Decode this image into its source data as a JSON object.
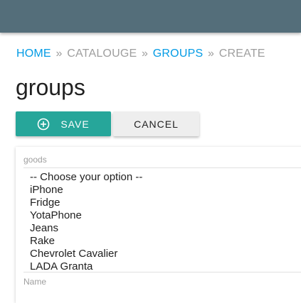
{
  "breadcrumb": {
    "items": [
      {
        "label": "HOME",
        "link": true
      },
      {
        "label": "CATALOUGE",
        "link": false
      },
      {
        "label": "GROUPS",
        "link": true
      },
      {
        "label": "CREATE",
        "link": false
      }
    ],
    "separator": "»"
  },
  "page": {
    "title": "groups"
  },
  "actions": {
    "save_label": "SAVE",
    "save_icon": "add-circle-icon",
    "cancel_label": "CANCEL"
  },
  "form": {
    "goods_label": "goods",
    "goods_options": [
      "-- Choose your option --",
      "iPhone",
      "Fridge",
      "YotaPhone",
      "Jeans",
      "Rake",
      "Chevrolet Cavalier",
      "LADA Granta"
    ],
    "name_label": "Name"
  },
  "colors": {
    "topbar": "#546e7a",
    "link": "#039be5",
    "primary_button": "#26a69a",
    "secondary_button": "#eeeeee"
  }
}
